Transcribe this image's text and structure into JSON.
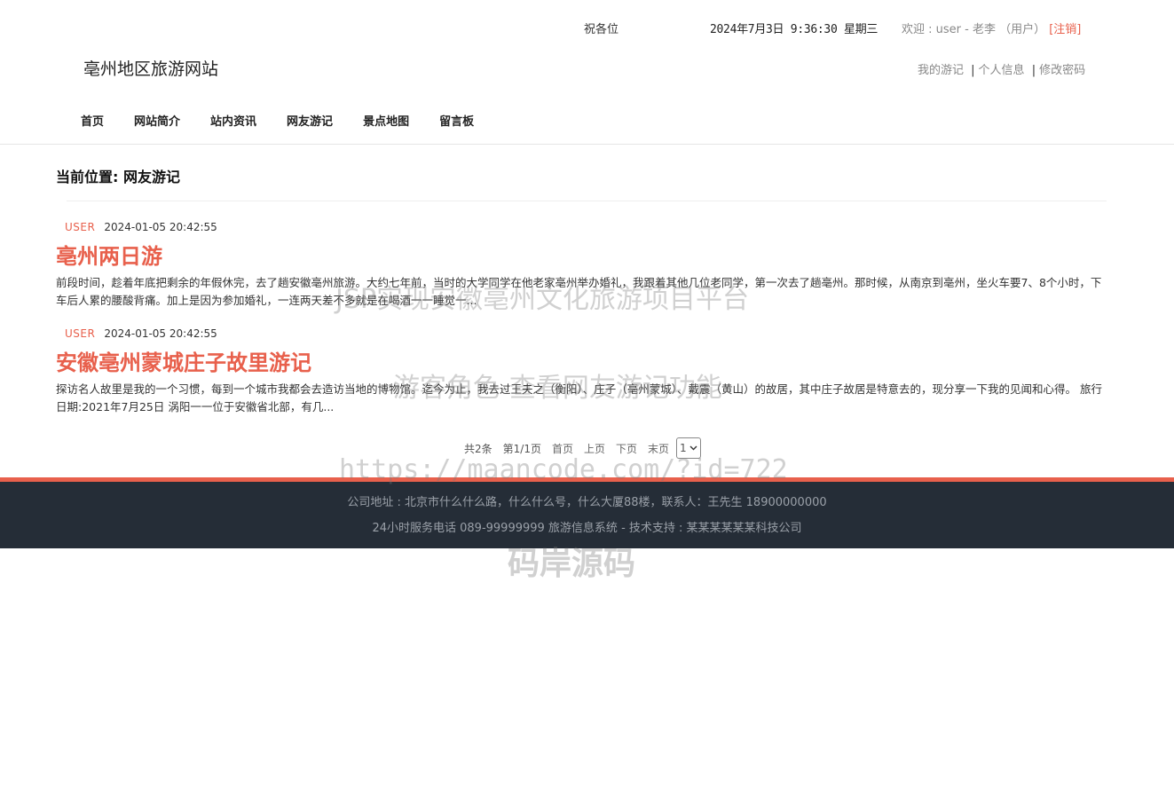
{
  "header": {
    "marquee_text": "祝各位",
    "datetime": "2024年7月3日 9:36:30 星期三",
    "welcome_prefix": "欢迎 : user - 老李 （用户）",
    "logout": "[注销]",
    "site_title": "亳州地区旅游网站",
    "user_links": [
      "我的游记",
      "个人信息",
      "修改密码"
    ],
    "separator": "|"
  },
  "nav": {
    "items": [
      "首页",
      "网站简介",
      "站内资讯",
      "网友游记",
      "景点地图",
      "留言板"
    ]
  },
  "breadcrumb": "当前位置: 网友游记",
  "posts": [
    {
      "author": "USER",
      "date": "2024-01-05 20:42:55",
      "title": "亳州两日游",
      "excerpt": "前段时间，趁着年底把剩余的年假休完，去了趟安徽亳州旅游。大约七年前，当时的大学同学在他老家亳州举办婚礼，我跟着其他几位老同学，第一次去了趟亳州。那时候，从南京到亳州，坐火车要7、8个小时，下车后人累的腰酸背痛。加上是因为参加婚礼，一连两天差不多就是在喝酒一一睡觉一..."
    },
    {
      "author": "USER",
      "date": "2024-01-05 20:42:55",
      "title": "安徽亳州蒙城庄子故里游记",
      "excerpt": "探访名人故里是我的一个习惯，每到一个城市我都会去造访当地的博物馆。迄今为止，我去过王夫之（衡阳）、庄子（亳州蒙城）、戴震（黄山）的故居，其中庄子故居是特意去的，现分享一下我的见闻和心得。 旅行日期:2021年7月25日 涡阳一一位于安徽省北部，有几..."
    }
  ],
  "pager": {
    "total": "共2条",
    "page_info": "第1/1页",
    "first": "首页",
    "prev": "上页",
    "next": "下页",
    "last": "末页",
    "selected": "1"
  },
  "footer": {
    "address": "公司地址 : 北京市什么什么路，什么什么号，什么大厦88楼，联系人：王先生 18900000000",
    "service": "24小时服务电话   089-99999999   旅游信息系统 - 技术支持 : 某某某某某某科技公司"
  },
  "watermarks": {
    "line1": "JSP实现安徽亳州文化旅游项目平台",
    "line2": "游客角色-查看网友游记功能",
    "line3": "https://maancode.com/?id=722",
    "line4": "码岸源码"
  },
  "colors": {
    "accent": "#e8604c",
    "footer_bg": "#252d37"
  }
}
